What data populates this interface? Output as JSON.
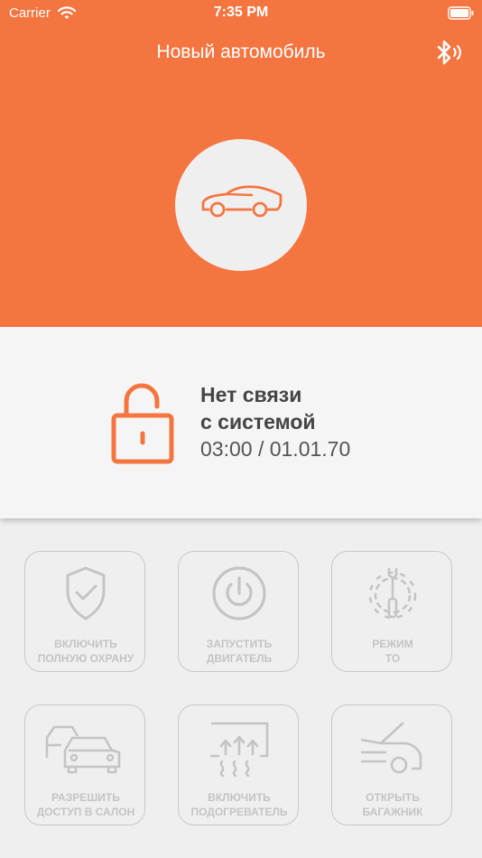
{
  "status_bar": {
    "carrier": "Carrier",
    "time": "7:35 PM"
  },
  "header": {
    "title": "Новый автомобиль"
  },
  "status": {
    "line1": "Нет связи",
    "line2": "с системой",
    "time": "03:00 / 01.01.70"
  },
  "colors": {
    "accent": "#f57541",
    "tile_icon": "#c4c4c4"
  },
  "tiles": [
    {
      "icon": "shield-check-icon",
      "line1": "ВКЛЮЧИТЬ",
      "line2": "ПОЛНУЮ ОХРАНУ"
    },
    {
      "icon": "power-icon",
      "line1": "ЗАПУСТИТЬ",
      "line2": "ДВИГАТЕЛЬ"
    },
    {
      "icon": "service-gear-icon",
      "line1": "РЕЖИМ",
      "line2": "ТО"
    },
    {
      "icon": "cars-icon",
      "line1": "РАЗРЕШИТЬ",
      "line2": "ДОСТУП В САЛОН"
    },
    {
      "icon": "window-heater-icon",
      "line1": "ВКЛЮЧИТЬ",
      "line2": "ПОДОГРЕВАТЕЛЬ"
    },
    {
      "icon": "trunk-icon",
      "line1": "ОТКРЫТЬ",
      "line2": "БАГАЖНИК"
    }
  ]
}
